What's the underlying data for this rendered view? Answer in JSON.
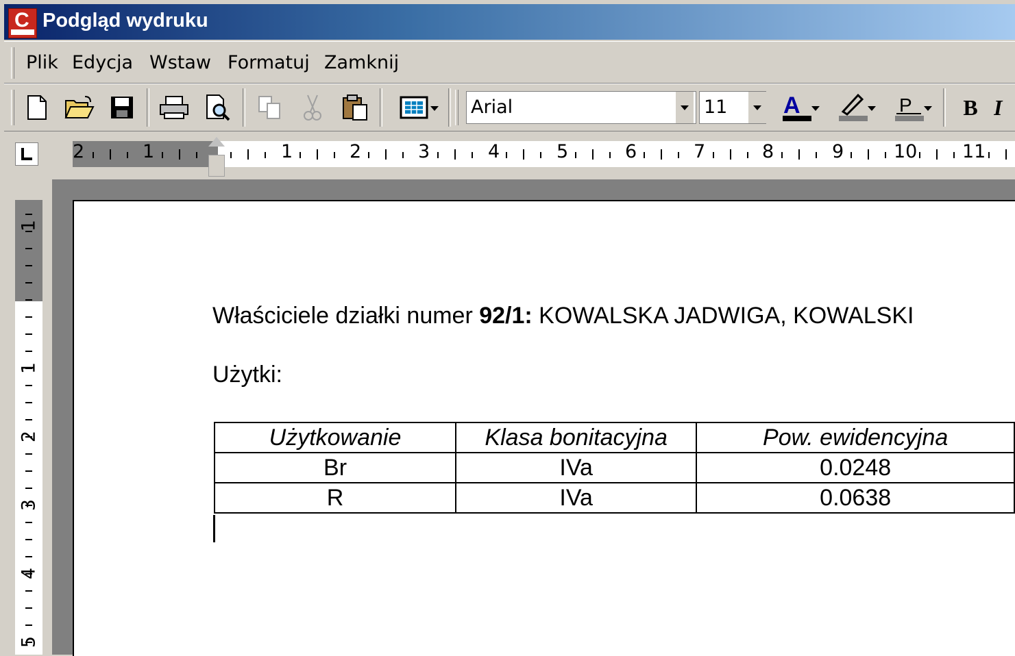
{
  "window": {
    "title": "Podgląd wydruku"
  },
  "menu": {
    "items": [
      "Plik",
      "Edycja",
      "Wstaw",
      "Formatuj",
      "Zamknij"
    ]
  },
  "toolbar": {
    "font_name": "Arial",
    "font_size": "11",
    "font_color": "#0000a0",
    "highlight_color": "#808080",
    "buttons": [
      "new-document-icon",
      "open-folder-icon",
      "save-icon",
      "print-icon",
      "print-preview-icon",
      "copy-icon",
      "cut-icon",
      "paste-icon",
      "table-icon",
      "font-color-icon",
      "highlight-icon",
      "paragraph-color-icon",
      "bold-icon"
    ],
    "bold_label": "B"
  },
  "ruler": {
    "horizontal_left": [
      "2",
      "1"
    ],
    "horizontal": [
      "1",
      "2",
      "3",
      "4",
      "5",
      "6",
      "7",
      "8",
      "9",
      "10",
      "11"
    ],
    "vertical": [
      "1",
      "1",
      "2",
      "3",
      "4",
      "5"
    ]
  },
  "document": {
    "owners_prefix": "Właściciele działki numer ",
    "parcel_number": "92/1:",
    "owners_names": " KOWALSKA JADWIGA, KOWALSKI",
    "uses_label": "Użytki:",
    "table": {
      "headers": [
        "Użytkowanie",
        "Klasa bonitacyjna",
        "Pow. ewidencyjna"
      ],
      "rows": [
        [
          "Br",
          "IVa",
          "0.0248"
        ],
        [
          "R",
          "IVa",
          "0.0638"
        ]
      ]
    }
  }
}
